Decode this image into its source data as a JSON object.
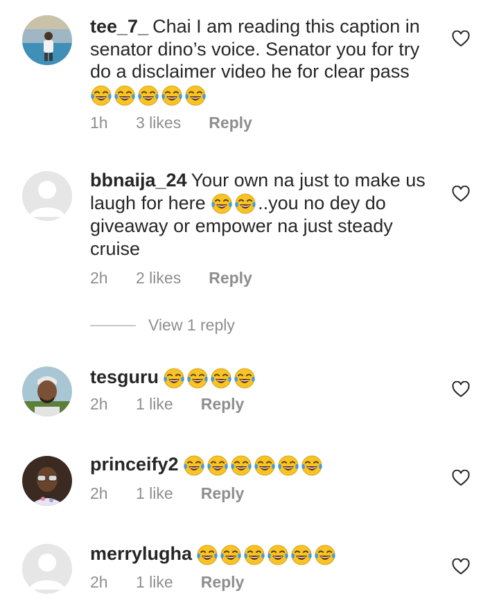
{
  "comments": [
    {
      "username": "tee_7_",
      "text": "Chai I am reading this caption in senator dino’s voice. Senator you for try do a disclaimer video he for clear pass",
      "emoji_count": 5,
      "time": "1h",
      "likes": "3 likes",
      "reply_label": "Reply",
      "avatar_icon": "user-photo-pool"
    },
    {
      "username": "bbnaija_24",
      "text_before": "Your own na just to make us laugh for here",
      "emoji_count": 2,
      "text_after": "..you no dey do giveaway or empower na just steady cruise",
      "time": "2h",
      "likes": "2 likes",
      "reply_label": "Reply",
      "avatar_icon": "default-avatar"
    },
    {
      "username": "tesguru",
      "emoji_count": 4,
      "time": "2h",
      "likes": "1 like",
      "reply_label": "Reply",
      "avatar_icon": "user-photo-cap"
    },
    {
      "username": "princeify2",
      "emoji_count": 6,
      "time": "2h",
      "likes": "1 like",
      "reply_label": "Reply",
      "avatar_icon": "user-photo-glasses"
    },
    {
      "username": "merrylugha",
      "emoji_count": 6,
      "time": "2h",
      "likes": "1 like",
      "reply_label": "Reply",
      "avatar_icon": "default-avatar"
    }
  ],
  "view_replies": "View 1 reply",
  "emoji_name": "face-with-tears-of-joy",
  "colors": {
    "text": "#262626",
    "secondary": "#8e8e8e",
    "divider": "#c7c7c7",
    "emoji_face": "#f7c325",
    "emoji_tears": "#3b9be8"
  }
}
